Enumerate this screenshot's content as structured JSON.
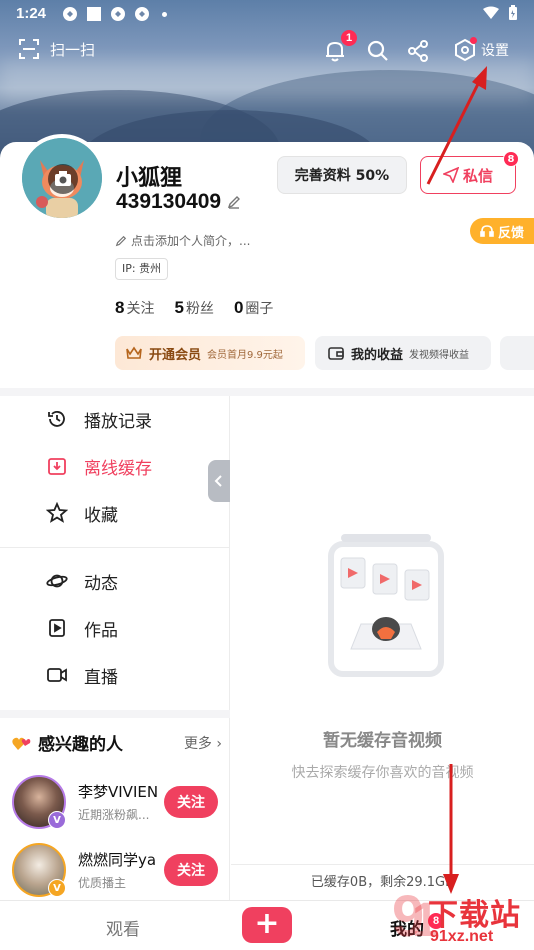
{
  "status_bar": {
    "time": "1:24"
  },
  "top_bar": {
    "scan_label": "扫一扫",
    "notification_count": "1",
    "settings_label": "设置"
  },
  "profile": {
    "name": "小狐狸",
    "uid": "439130409",
    "complete_profile": "完善资料 50%",
    "message_label": "私信",
    "message_badge": "8",
    "feedback_label": "反馈",
    "intro_placeholder": "点击添加个人简介，...",
    "ip_tag": "IP: 贵州",
    "stats": [
      {
        "count": "8",
        "label": "关注"
      },
      {
        "count": "5",
        "label": "粉丝"
      },
      {
        "count": "0",
        "label": "圈子"
      }
    ],
    "vip": {
      "title": "开通会员",
      "subtitle": "会员首月9.9元起"
    },
    "income": {
      "title": "我的收益",
      "subtitle": "发视频得收益"
    }
  },
  "menu": {
    "group1": [
      {
        "label": "播放记录",
        "icon": "history-icon",
        "active": false
      },
      {
        "label": "离线缓存",
        "icon": "download-icon",
        "active": true
      },
      {
        "label": "收藏",
        "icon": "star-icon",
        "active": false
      }
    ],
    "group2": [
      {
        "label": "动态",
        "icon": "planet-icon"
      },
      {
        "label": "作品",
        "icon": "works-icon"
      },
      {
        "label": "直播",
        "icon": "live-camera-icon"
      }
    ]
  },
  "interests": {
    "title": "感兴趣的人",
    "more": "更多",
    "people": [
      {
        "name": "李梦VIVIEN",
        "desc": "近期涨粉飙...",
        "follow": "关注",
        "badge_color": "#9a6bd9"
      },
      {
        "name": "燃燃同学ya",
        "desc": "优质播主",
        "follow": "关注",
        "badge_color": "#f5a623"
      }
    ]
  },
  "empty_state": {
    "title": "暂无缓存音视频",
    "subtitle": "快去探索缓存你喜欢的音视频",
    "storage": "已缓存0B，剩余29.1GB"
  },
  "bottom_nav": {
    "tab_watch": "观看",
    "tab_mine": "我的",
    "mine_badge": "8"
  },
  "watermark": {
    "text": "下载站",
    "url": "91xz.net"
  },
  "colors": {
    "accent": "#f0405f",
    "vip": "#8a4a12",
    "feedback": "#ffb12b"
  }
}
